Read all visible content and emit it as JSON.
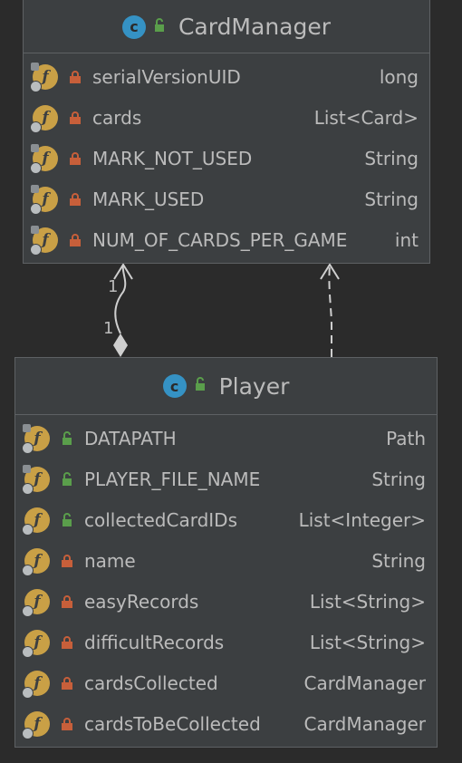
{
  "card_manager": {
    "name": "CardManager",
    "icon": "class-icon",
    "fields": [
      {
        "name": "serialVersionUID",
        "type": "long",
        "visibility": "private",
        "static": true
      },
      {
        "name": "cards",
        "type": "List<Card>",
        "visibility": "private",
        "static": false
      },
      {
        "name": "MARK_NOT_USED",
        "type": "String",
        "visibility": "private",
        "static": true
      },
      {
        "name": "MARK_USED",
        "type": "String",
        "visibility": "private",
        "static": true
      },
      {
        "name": "NUM_OF_CARDS_PER_GAME",
        "type": "int",
        "visibility": "private",
        "static": true
      }
    ]
  },
  "player": {
    "name": "Player",
    "icon": "class-icon",
    "fields": [
      {
        "name": "DATAPATH",
        "type": "Path",
        "visibility": "public",
        "static": true
      },
      {
        "name": "PLAYER_FILE_NAME",
        "type": "String",
        "visibility": "public",
        "static": true
      },
      {
        "name": "collectedCardIDs",
        "type": "List<Integer>",
        "visibility": "public",
        "static": false
      },
      {
        "name": "name",
        "type": "String",
        "visibility": "private",
        "static": false
      },
      {
        "name": "easyRecords",
        "type": "List<String>",
        "visibility": "private",
        "static": false
      },
      {
        "name": "difficultRecords",
        "type": "List<String>",
        "visibility": "private",
        "static": false
      },
      {
        "name": "cardsCollected",
        "type": "CardManager",
        "visibility": "private",
        "static": false
      },
      {
        "name": "cardsToBeCollected",
        "type": "CardManager",
        "visibility": "private",
        "static": false
      }
    ]
  },
  "relations": {
    "composition_multiplicity_top": "1",
    "composition_multiplicity_bottom": "1"
  },
  "colors": {
    "background": "#2b2b2b",
    "box": "#3c3f41",
    "class_icon": "#3592c4",
    "field_icon": "#c9a046",
    "private_lock": "#c75f3a",
    "public_lock": "#5a9e4b"
  }
}
